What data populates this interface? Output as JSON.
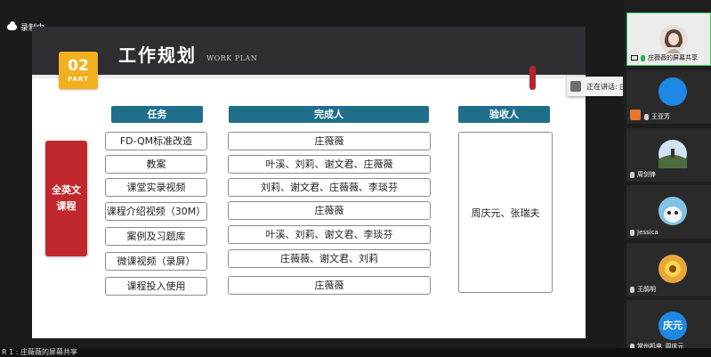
{
  "recording": {
    "label": "录制中"
  },
  "slide": {
    "badge_number": "02",
    "badge_part": "PART",
    "title": "工作规划",
    "subtitle": "WORK PLAN",
    "headers": {
      "task": "任务",
      "completer": "完成人",
      "acceptor": "验收人"
    },
    "course": "全英文课程",
    "rows": [
      {
        "task": "FD-QM标准改造",
        "completer": "庄薇薇"
      },
      {
        "task": "教案",
        "completer": "叶溪、刘莉、谢文君、庄薇薇"
      },
      {
        "task": "课堂实录视频",
        "completer": "刘莉、谢文君、庄薇薇、李琰芬"
      },
      {
        "task": "课程介绍视频（30M）",
        "completer": "庄薇薇"
      },
      {
        "task": "案例及习题库",
        "completer": "叶溪、刘莉、谢文君、李琰芬"
      },
      {
        "task": "微课视频（录屏）",
        "completer": "庄薇薇、谢文君、刘莉"
      },
      {
        "task": "课程投入使用",
        "completer": "庄薇薇"
      }
    ],
    "acceptor": "周庆元、张瑞夫",
    "colors": {
      "header_bg": "#2e2e33",
      "badge": "#f2b01e",
      "col_header": "#1f6f8b",
      "course_box": "#c0282d"
    }
  },
  "speaking": {
    "label": "正在讲话: 庄薇薇;"
  },
  "participants": [
    {
      "name": "庄薇薇的屏幕共享",
      "icon": "avatar-girl-icon",
      "active": true
    },
    {
      "name": "王亚芳",
      "icon": "avatar-orange-icon"
    },
    {
      "name": "周剑锋",
      "icon": "avatar-landscape-icon"
    },
    {
      "name": "Jessica",
      "icon": "avatar-cartoon-icon"
    },
    {
      "name": "王鹃明",
      "icon": "avatar-flower-icon"
    },
    {
      "name": "常州机电_周庆元",
      "icon": "avatar-text-icon",
      "avatar_text": "庆元"
    }
  ],
  "bottom_bar": {
    "text": "R 1 : 庄薇薇的屏幕共享"
  }
}
